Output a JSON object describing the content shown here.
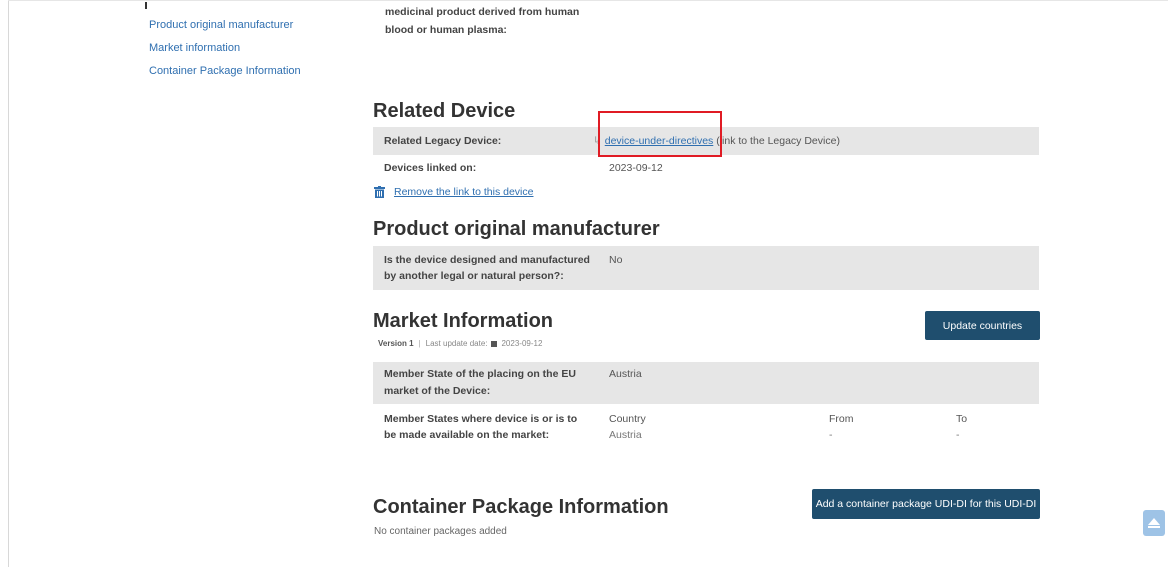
{
  "sidebar": {
    "items": [
      {
        "label": "Product original manufacturer"
      },
      {
        "label": "Market information"
      },
      {
        "label": "Container Package Information"
      }
    ]
  },
  "top_text": {
    "line1": "medicinal product derived from human",
    "line2": "blood or human plasma:"
  },
  "related_device": {
    "title": "Related Device",
    "legacy_label": "Related Legacy Device:",
    "legacy_link": "device-under-directives",
    "legacy_suffix": "(link to the Legacy Device)",
    "linked_on_label": "Devices linked on:",
    "linked_on_value": "2023-09-12",
    "remove_link": "Remove the link to this device"
  },
  "manufacturer": {
    "title": "Product original manufacturer",
    "question_line1": "Is the device designed and manufactured",
    "question_line2": "by another legal or natural person?:",
    "answer": "No"
  },
  "market": {
    "title": "Market Information",
    "version": "Version 1",
    "last_update_label": "Last update date:",
    "last_update_value": "2023-09-12",
    "update_button": "Update countries",
    "placing_label_line1": "Member State of the placing on the EU",
    "placing_label_line2": "market of the Device:",
    "placing_value": "Austria",
    "available_label_line1": "Member States where device is or is to",
    "available_label_line2": "be made available on the market:",
    "table_headers": {
      "country": "Country",
      "from": "From",
      "to": "To"
    },
    "table_rows": [
      {
        "country": "Austria",
        "from": "-",
        "to": "-"
      }
    ]
  },
  "container": {
    "title": "Container Package Information",
    "add_button": "Add a container package UDI-DI for this UDI-DI",
    "empty_text": "No container packages added"
  },
  "colors": {
    "link": "#2f6fb0",
    "button": "#1f4e6e",
    "highlight": "#e01b24",
    "row_grey": "#e6e6e6"
  }
}
